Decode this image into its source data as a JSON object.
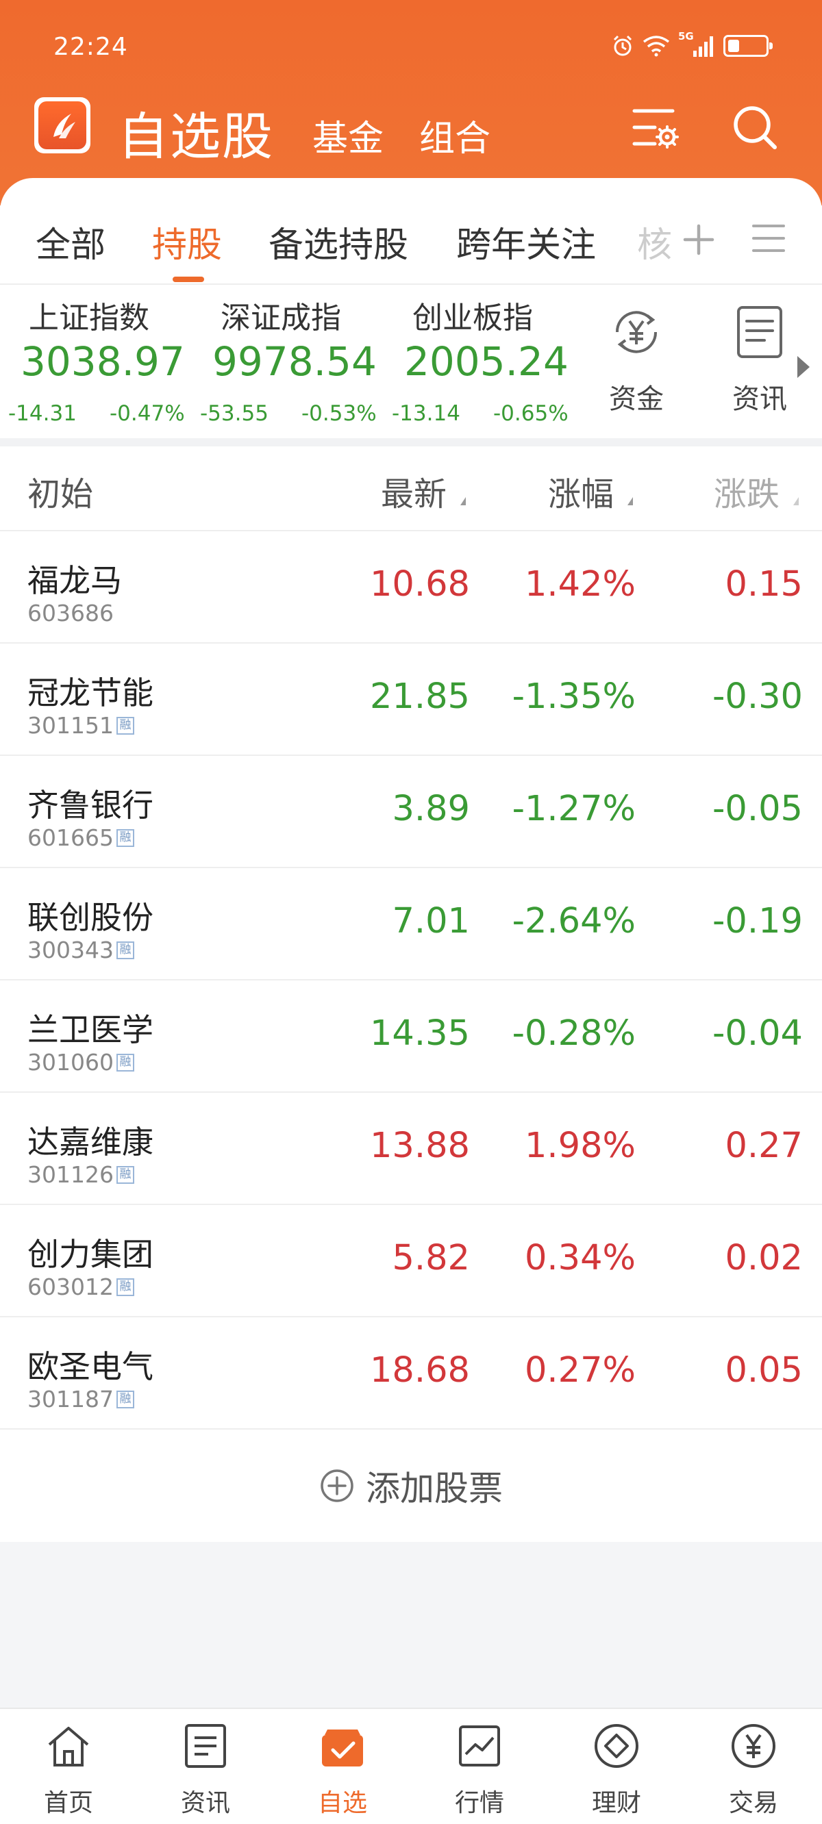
{
  "status": {
    "time": "22:24",
    "network": "5G",
    "battery_level": 0.3
  },
  "header": {
    "title": "自选股",
    "subtabs": [
      "基金",
      "组合"
    ],
    "filter_icon": "filter-settings-icon",
    "search_icon": "search-icon"
  },
  "tabs": {
    "items": [
      "全部",
      "持股",
      "备选持股",
      "跨年关注"
    ],
    "active_index": 1,
    "overflow_fragment": "核"
  },
  "indices": [
    {
      "name": "上证指数",
      "value": "3038.97",
      "change": "-14.31",
      "pct": "-0.47%"
    },
    {
      "name": "深证成指",
      "value": "9978.54",
      "change": "-53.55",
      "pct": "-0.53%"
    },
    {
      "name": "创业板指",
      "value": "2005.24",
      "change": "-13.14",
      "pct": "-0.65%"
    }
  ],
  "quick": {
    "funds": "资金",
    "news": "资讯"
  },
  "list_header": {
    "name": "初始",
    "price": "最新",
    "pct": "涨幅",
    "chg": "涨跌"
  },
  "stocks": [
    {
      "name": "福龙马",
      "code": "603686",
      "price": "10.68",
      "pct": "1.42%",
      "chg": "0.15",
      "margin": ""
    },
    {
      "name": "冠龙节能",
      "code": "301151",
      "price": "21.85",
      "pct": "-1.35%",
      "chg": "-0.30",
      "margin": "融"
    },
    {
      "name": "齐鲁银行",
      "code": "601665",
      "price": "3.89",
      "pct": "-1.27%",
      "chg": "-0.05",
      "margin": "融"
    },
    {
      "name": "联创股份",
      "code": "300343",
      "price": "7.01",
      "pct": "-2.64%",
      "chg": "-0.19",
      "margin": "融"
    },
    {
      "name": "兰卫医学",
      "code": "301060",
      "price": "14.35",
      "pct": "-0.28%",
      "chg": "-0.04",
      "margin": "融"
    },
    {
      "name": "达嘉维康",
      "code": "301126",
      "price": "13.88",
      "pct": "1.98%",
      "chg": "0.27",
      "margin": "融"
    },
    {
      "name": "创力集团",
      "code": "603012",
      "price": "5.82",
      "pct": "0.34%",
      "chg": "0.02",
      "margin": "融"
    },
    {
      "name": "欧圣电气",
      "code": "301187",
      "price": "18.68",
      "pct": "0.27%",
      "chg": "0.05",
      "margin": "融"
    }
  ],
  "add_stock": "添加股票",
  "nav": [
    "首页",
    "资讯",
    "自选",
    "行情",
    "理财",
    "交易"
  ],
  "nav_active": 2,
  "colors": {
    "brand": "#ee6a2b",
    "up": "#d2373a",
    "down": "#3a9b35"
  }
}
